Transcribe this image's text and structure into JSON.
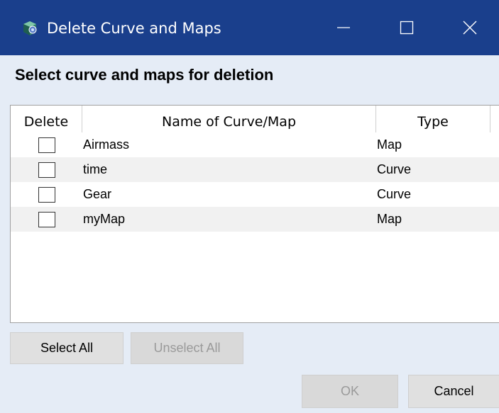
{
  "window": {
    "title": "Delete Curve and Maps",
    "accent": "#1a3f8c"
  },
  "heading": "Select curve and maps for deletion",
  "table": {
    "columns": [
      "Delete",
      "Name of Curve/Map",
      "Type"
    ],
    "rows": [
      {
        "checked": false,
        "name": "Airmass",
        "type": "Map"
      },
      {
        "checked": false,
        "name": "time",
        "type": "Curve"
      },
      {
        "checked": false,
        "name": "Gear",
        "type": "Curve"
      },
      {
        "checked": false,
        "name": "myMap",
        "type": "Map"
      }
    ]
  },
  "buttons": {
    "select_all": "Select All",
    "unselect_all": "Unselect All",
    "ok": "OK",
    "cancel": "Cancel"
  },
  "icons": {
    "app": "app-icon",
    "minimize": "minimize-icon",
    "maximize": "maximize-icon",
    "close": "close-icon"
  }
}
